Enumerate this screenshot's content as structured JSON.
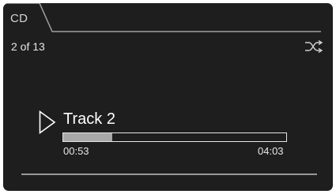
{
  "header": {
    "source_tab_label": "CD",
    "track_position": "2 of 13",
    "shuffle_icon": "shuffle-icon"
  },
  "player": {
    "play_icon": "play-icon",
    "track_title": "Track 2",
    "progress_fraction": 0.22,
    "elapsed_time": "00:53",
    "total_time": "04:03"
  },
  "colors": {
    "screen_background": "#1e1e1e",
    "text": "#e6e6e6",
    "progress_fill": "#a8a8a8",
    "lines": "#9a9a9a"
  }
}
